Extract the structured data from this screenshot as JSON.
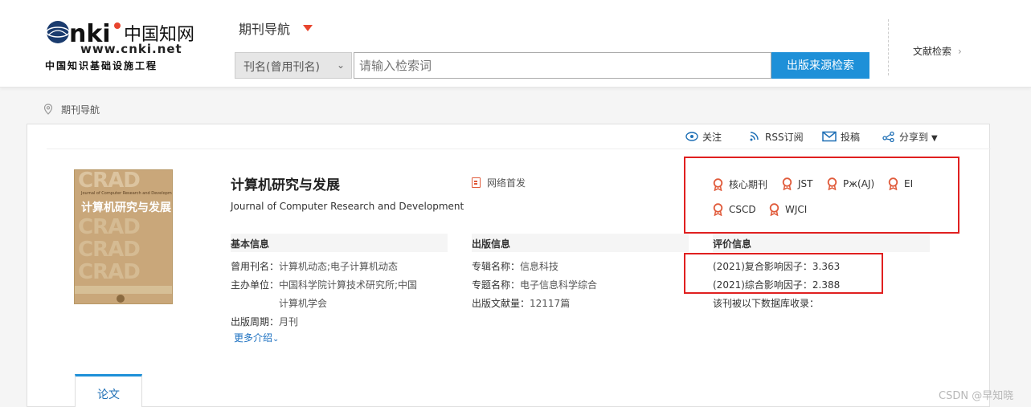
{
  "header": {
    "logo_url_text": "www.cnki.net",
    "logo_tagline": "中国知识基础设施工程",
    "nav_title": "期刊导航",
    "search": {
      "field_selected": "刊名(曾用刊名)",
      "placeholder": "请输入检索词",
      "button_label": "出版来源检索"
    },
    "right_link": "文献检索"
  },
  "breadcrumb": {
    "label": "期刊导航"
  },
  "toolbar": {
    "follow": "关注",
    "rss": "RSS订阅",
    "submit": "投稿",
    "share": "分享到"
  },
  "journal": {
    "title": "计算机研究与发展",
    "english_title": "Journal of Computer Research and Development",
    "online_first": "网络首发",
    "cover": {
      "brand": "CRAD",
      "title": "计算机研究与发展"
    },
    "badges": [
      "核心期刊",
      "JST",
      "Pж(AJ)",
      "EI",
      "CSCD",
      "WJCI"
    ]
  },
  "basic_info": {
    "heading": "基本信息",
    "former_name_label": "曾用刊名：",
    "former_name_value": "计算机动态;电子计算机动态",
    "sponsor_label": "主办单位：",
    "sponsor_value_line1": "中国科学院计算技术研究所;中国",
    "sponsor_value_line2": "计算机学会",
    "frequency_label": "出版周期：",
    "frequency_value": "月刊",
    "more_label": "更多介绍"
  },
  "publish_info": {
    "heading": "出版信息",
    "series_label": "专辑名称：",
    "series_value": "信息科技",
    "topic_label": "专题名称：",
    "topic_value": "电子信息科学综合",
    "count_label": "出版文献量：",
    "count_value": "12117篇"
  },
  "eval_info": {
    "heading": "评价信息",
    "compound_if": "(2021)复合影响因子：3.363",
    "comprehensive_if": "(2021)综合影响因子：2.388",
    "indexed_by": "该刊被以下数据库收录："
  },
  "tabs": {
    "papers": "论文"
  },
  "watermark": "CSDN @早知晓",
  "colors": {
    "accent": "#1e90d8",
    "highlight_box": "#e02020",
    "caret": "#e8452e"
  }
}
